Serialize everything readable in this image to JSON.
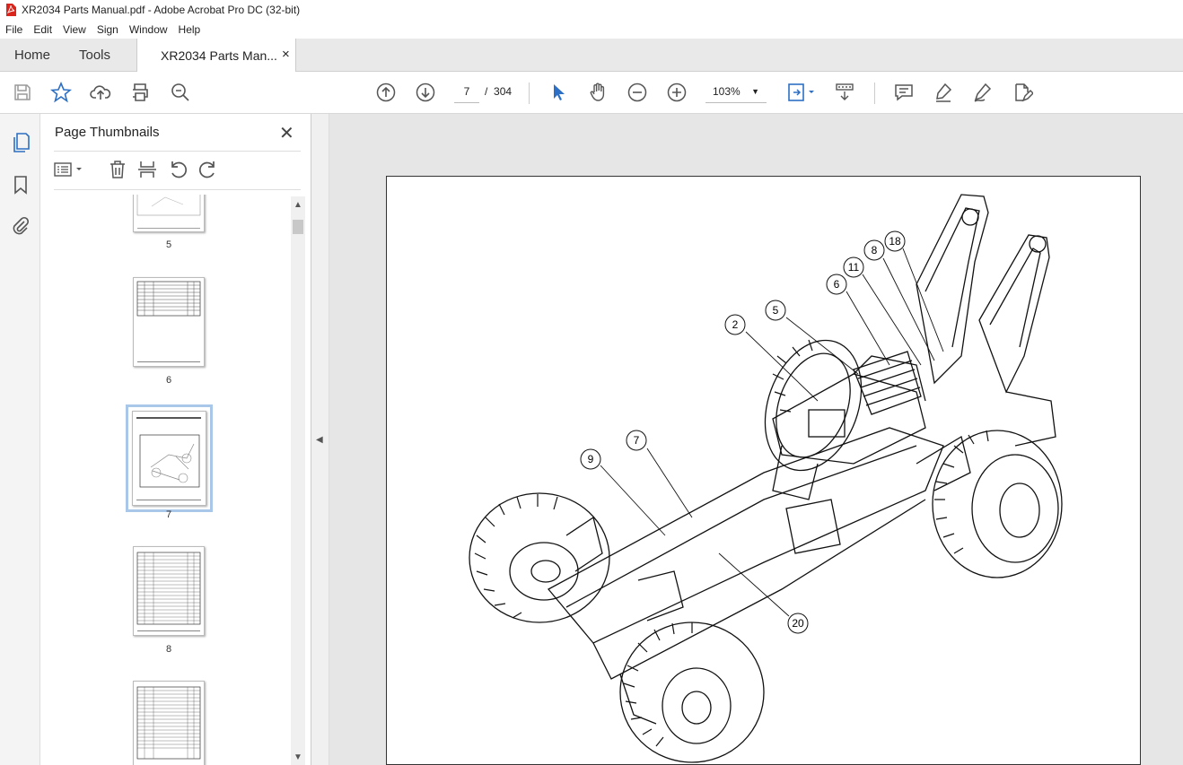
{
  "window": {
    "title": "XR2034 Parts Manual.pdf - Adobe Acrobat Pro DC (32-bit)"
  },
  "menu": [
    "File",
    "Edit",
    "View",
    "Sign",
    "Window",
    "Help"
  ],
  "tabs": {
    "home": "Home",
    "tools": "Tools",
    "document": "XR2034 Parts Man...",
    "close": "×"
  },
  "toolbar": {
    "current_page": "7",
    "separator": "/",
    "total_pages": "304",
    "zoom": "103%",
    "icons": [
      "save-icon",
      "bookmark-star-icon",
      "upload-icon",
      "print-icon",
      "search-zoom-icon",
      "page-up-icon",
      "page-down-icon",
      "select-arrow-icon",
      "hand-icon",
      "zoom-out-icon",
      "zoom-in-icon",
      "fit-page-icon",
      "scroll-mode-icon",
      "comment-icon",
      "highlight-icon",
      "draw-icon",
      "fill-sign-icon"
    ]
  },
  "rail": {
    "icons": [
      "page-thumbnails-icon",
      "bookmarks-icon",
      "attachments-icon"
    ]
  },
  "panel": {
    "title": "Page Thumbnails",
    "close": "✕",
    "thumbnails": [
      {
        "label": "5",
        "selected": false
      },
      {
        "label": "6",
        "selected": false
      },
      {
        "label": "7",
        "selected": true
      },
      {
        "label": "8",
        "selected": false
      },
      {
        "label": "",
        "selected": false
      }
    ]
  },
  "callouts": [
    "2",
    "5",
    "6",
    "11",
    "8",
    "18",
    "7",
    "9",
    "20"
  ]
}
